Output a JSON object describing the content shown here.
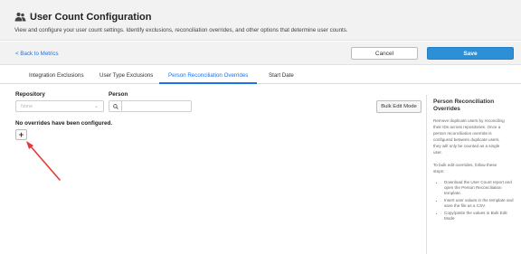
{
  "header": {
    "title": "User Count Configuration",
    "subtitle": "View and configure your user count settings. Identify exclusions, reconciliation overrides, and other options that determine user counts."
  },
  "toolbar": {
    "back_label": "< Back to Metrics",
    "cancel_label": "Cancel",
    "save_label": "Save"
  },
  "tabs": [
    {
      "label": "Integration Exclusions"
    },
    {
      "label": "User Type Exclusions"
    },
    {
      "label": "Person Reconciliation Overrides"
    },
    {
      "label": "Start Date"
    }
  ],
  "filters": {
    "repository_label": "Repository",
    "repository_placeholder": "None",
    "person_label": "Person",
    "person_value": ""
  },
  "overrides": {
    "empty_message": "No overrides have been configured.",
    "add_label": "+"
  },
  "bulk_edit_label": "Bulk Edit Mode",
  "side_panel": {
    "title": "Person Reconciliation Overrides",
    "para1": "Remove duplicate users by reconciling their IDs across repositories. Once a person reconciliation override is configured between duplicate users, they will only be counted as a single user.",
    "para2": "To bulk edit overrides, follow these steps:",
    "steps": [
      "Download the User Count report and open the Person Reconciliation template.",
      "Insert user values in the template and save the file as a CSV.",
      "Copy/paste the values in Bulk Edit Mode"
    ]
  },
  "colors": {
    "accent": "#1a73e8",
    "save_button": "#2d8fd5",
    "header_bg": "#f2f2f2",
    "arrow": "#e53935"
  }
}
